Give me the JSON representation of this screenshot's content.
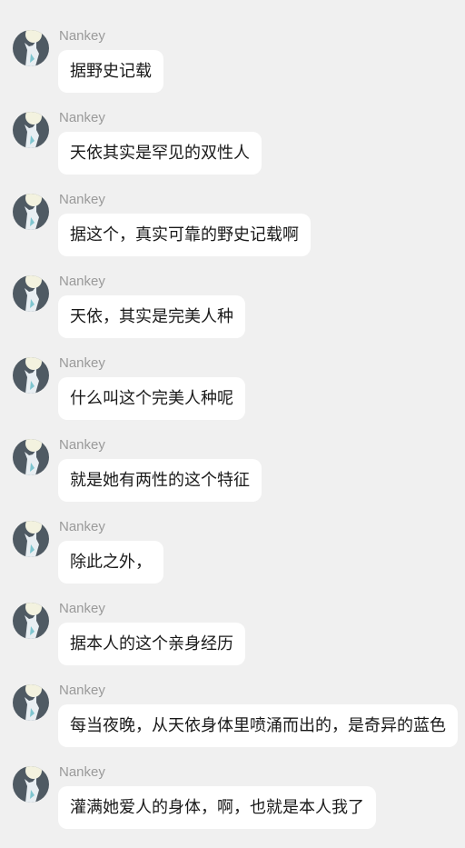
{
  "messages": [
    {
      "sender": "Nankey",
      "text": "据野史记载"
    },
    {
      "sender": "Nankey",
      "text": "天依其实是罕见的双性人"
    },
    {
      "sender": "Nankey",
      "text": "据这个，真实可靠的野史记载啊"
    },
    {
      "sender": "Nankey",
      "text": "天依，其实是完美人种"
    },
    {
      "sender": "Nankey",
      "text": "什么叫这个完美人种呢"
    },
    {
      "sender": "Nankey",
      "text": "就是她有两性的这个特征"
    },
    {
      "sender": "Nankey",
      "text": "除此之外，"
    },
    {
      "sender": "Nankey",
      "text": "据本人的这个亲身经历"
    },
    {
      "sender": "Nankey",
      "text": "每当夜晚，从天依身体里喷涌而出的，是奇异的蓝色"
    },
    {
      "sender": "Nankey",
      "text": "灌满她爱人的身体，啊，也就是本人我了"
    }
  ],
  "avatar_icon": "cat-silhouette-avatar-icon",
  "colors": {
    "background": "#f0f0f0",
    "bubble": "#ffffff",
    "sender": "#9a9a9a",
    "text": "#1a1a1a"
  }
}
